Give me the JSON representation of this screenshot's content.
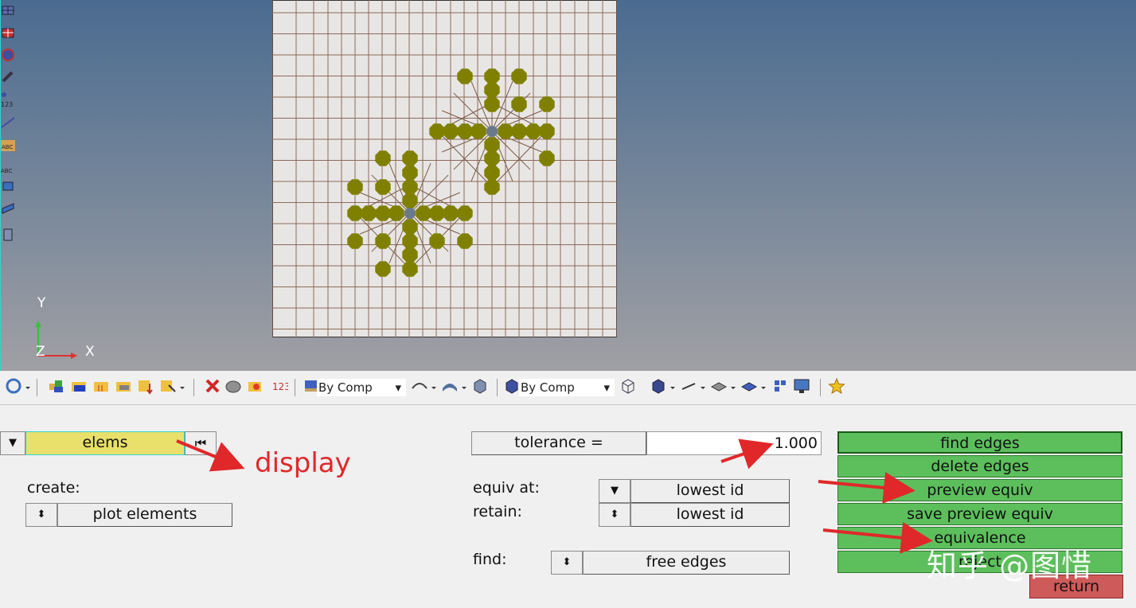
{
  "viewport": {
    "axis_y": "Y",
    "axis_z": "Z",
    "axis_x": "X",
    "left_toolbar_labels": {
      "a": "123",
      "b": "ABC",
      "c": "ABC"
    }
  },
  "toolbar": {
    "select1": "By Comp",
    "select2": "By Comp"
  },
  "panel": {
    "entity_selector": "elems",
    "create_label": "create:",
    "create_value": "plot elements",
    "tolerance_label": "tolerance =",
    "tolerance_value": "1.000",
    "equiv_at_label": "equiv at:",
    "equiv_at_value": "lowest id",
    "retain_label": "retain:",
    "retain_value": "lowest id",
    "find_label": "find:",
    "find_value": "free edges",
    "actions": [
      "find edges",
      "delete edges",
      "preview equiv",
      "save preview equiv",
      "equivalence",
      "reject"
    ],
    "return_label": "return"
  },
  "annotations": {
    "display": "display",
    "watermark": "知乎 @图惜"
  },
  "colors": {
    "green_button": "#5cbf5c",
    "return_button": "#cf5a5a",
    "node_olive": "#808000",
    "annotation_red": "#e0282a",
    "entity_yellow": "#e8e06a"
  }
}
